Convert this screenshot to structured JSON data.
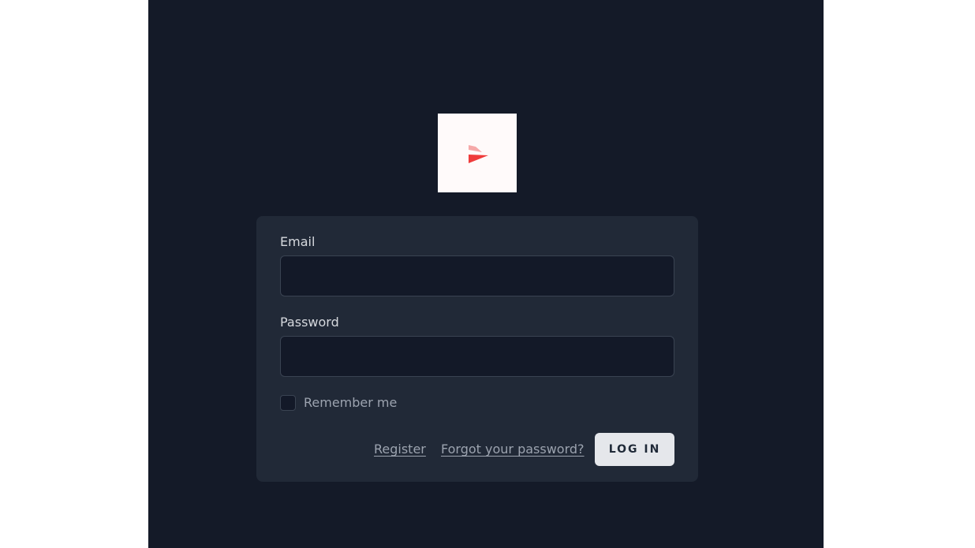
{
  "logo": {
    "icon": "brand-logo-icon",
    "colors": {
      "primary": "#ef3b3b",
      "secondary": "#f6a9a9"
    }
  },
  "form": {
    "email": {
      "label": "Email",
      "value": "",
      "placeholder": ""
    },
    "password": {
      "label": "Password",
      "value": "",
      "placeholder": ""
    },
    "remember": {
      "label": "Remember me",
      "checked": false
    },
    "register_link": "Register",
    "forgot_link": "Forgot your password?",
    "login_button": "Log in"
  },
  "colors": {
    "page_background": "#141a28",
    "card_background": "#212937",
    "input_background": "#131928",
    "button_background": "#e5e7eb"
  }
}
